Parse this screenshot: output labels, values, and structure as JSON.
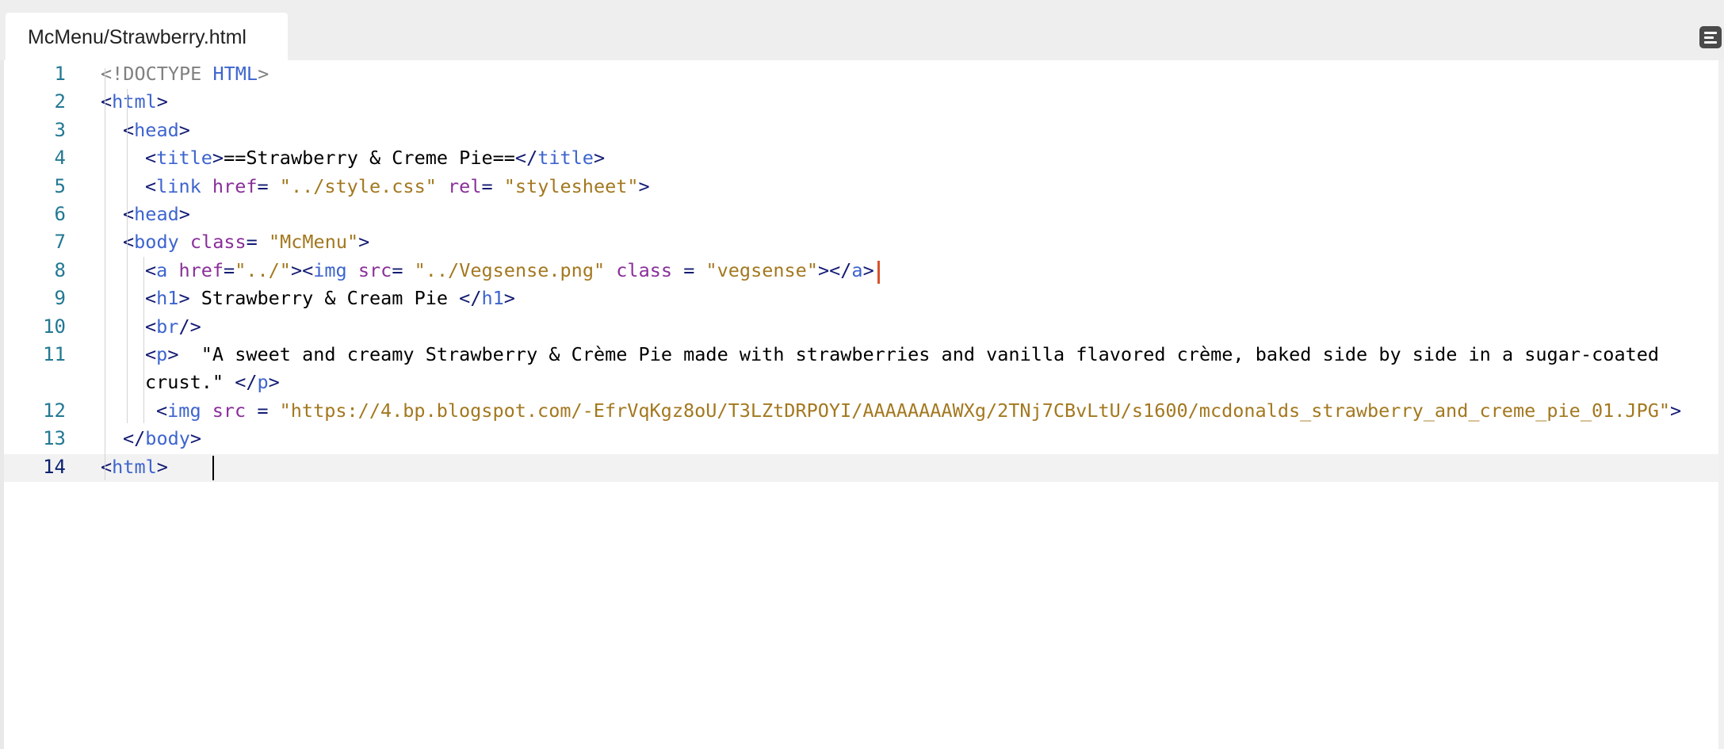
{
  "tab": {
    "title": "McMenu/Strawberry.html"
  },
  "toolbar": {
    "menu_icon": "menu-lines-icon"
  },
  "editor": {
    "line_numbers": [
      "1",
      "2",
      "3",
      "4",
      "5",
      "6",
      "7",
      "8",
      "9",
      "10",
      "11",
      "12",
      "13",
      "14"
    ],
    "current_line": 14,
    "lines": [
      {
        "segments": [
          [
            "dt",
            "<!DOCTYPE "
          ],
          [
            "t",
            "HTML"
          ],
          [
            "dt",
            ">"
          ]
        ]
      },
      {
        "segments": [
          [
            "br",
            "<"
          ],
          [
            "t",
            "html"
          ],
          [
            "br",
            ">"
          ]
        ]
      },
      {
        "segments": [
          [
            "br",
            "<"
          ],
          [
            "t",
            "head"
          ],
          [
            "br",
            ">"
          ]
        ]
      },
      {
        "segments": [
          [
            "br",
            "<"
          ],
          [
            "t",
            "title"
          ],
          [
            "br",
            ">"
          ],
          [
            "",
            "==Strawberry & Creme Pie=="
          ],
          [
            "br",
            "</"
          ],
          [
            "t",
            "title"
          ],
          [
            "br",
            ">"
          ]
        ]
      },
      {
        "segments": [
          [
            "br",
            "<"
          ],
          [
            "t",
            "link "
          ],
          [
            "attr",
            "href"
          ],
          [
            "br",
            "= "
          ],
          [
            "str",
            "\"../style.css\""
          ],
          [
            "attr",
            " rel"
          ],
          [
            "br",
            "= "
          ],
          [
            "str",
            "\"stylesheet\""
          ],
          [
            "br",
            ">"
          ]
        ]
      },
      {
        "segments": [
          [
            "br",
            "<"
          ],
          [
            "t",
            "head"
          ],
          [
            "br",
            ">"
          ]
        ]
      },
      {
        "segments": [
          [
            "br",
            "<"
          ],
          [
            "t",
            "body "
          ],
          [
            "attr",
            "class"
          ],
          [
            "br",
            "= "
          ],
          [
            "str",
            "\"McMenu\""
          ],
          [
            "br",
            ">"
          ]
        ]
      },
      {
        "segments": [
          [
            "br",
            "<"
          ],
          [
            "t",
            "a "
          ],
          [
            "attr",
            "href"
          ],
          [
            "br",
            "="
          ],
          [
            "str",
            "\"../\""
          ],
          [
            "br",
            ">"
          ],
          [
            "br",
            "<"
          ],
          [
            "t",
            "img "
          ],
          [
            "attr",
            "src"
          ],
          [
            "br",
            "= "
          ],
          [
            "str",
            "\"../Vegsense.png\""
          ],
          [
            "attr",
            " class "
          ],
          [
            "br",
            "= "
          ],
          [
            "str",
            "\"vegsense\""
          ],
          [
            "br",
            ">"
          ],
          [
            "br",
            "</"
          ],
          [
            "t",
            "a"
          ],
          [
            "br",
            ">"
          ]
        ]
      },
      {
        "segments": [
          [
            "br",
            "<"
          ],
          [
            "t",
            "h1"
          ],
          [
            "br",
            ">"
          ],
          [
            "",
            " Strawberry & Cream Pie "
          ],
          [
            "br",
            "</"
          ],
          [
            "t",
            "h1"
          ],
          [
            "br",
            ">"
          ]
        ]
      },
      {
        "segments": [
          [
            "br",
            "<"
          ],
          [
            "t",
            "br"
          ],
          [
            "br",
            "/>"
          ]
        ]
      },
      {
        "segments": [
          [
            "br",
            "<"
          ],
          [
            "t",
            "p"
          ],
          [
            "br",
            ">"
          ],
          [
            "",
            "  \"A sweet and creamy Strawberry & Crème Pie made with strawberries and vanilla flavored crème, baked side by side in a sugar-coated"
          ]
        ]
      },
      {
        "segments": [
          [
            "",
            "crust.\" "
          ],
          [
            "br",
            "</"
          ],
          [
            "t",
            "p"
          ],
          [
            "br",
            ">"
          ]
        ]
      },
      {
        "segments": [
          [
            "br",
            "<"
          ],
          [
            "t",
            "img "
          ],
          [
            "attr",
            "src "
          ],
          [
            "br",
            "= "
          ],
          [
            "str",
            "\"https://4.bp.blogspot.com/-EfrVqKgz8oU/T3LZtDRPOYI/AAAAAAAAWXg/2TNj7CBvLtU/s1600/mcdonalds_strawberry_and_creme_pie_01.JPG\""
          ],
          [
            "br",
            ">"
          ]
        ]
      },
      {
        "segments": [
          [
            "br",
            "</"
          ],
          [
            "t",
            "body"
          ],
          [
            "br",
            ">"
          ]
        ]
      },
      {
        "segments": [
          [
            "br",
            "<"
          ],
          [
            "t",
            "html"
          ],
          [
            "br",
            ">"
          ]
        ]
      }
    ]
  }
}
